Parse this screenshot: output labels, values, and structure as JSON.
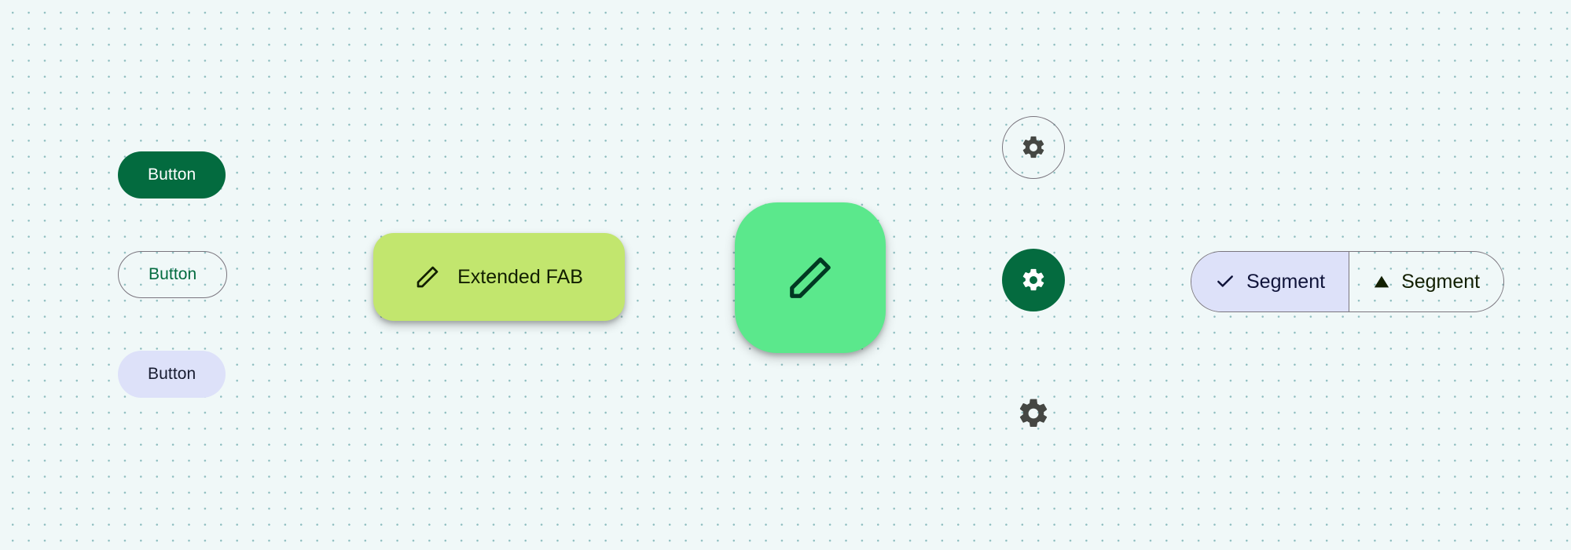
{
  "buttons": {
    "filled": "Button",
    "outlined": "Button",
    "tonal": "Button"
  },
  "extended_fab": {
    "label": "Extended FAB"
  },
  "segmented": {
    "segment1": "Segment",
    "segment2": "Segment"
  },
  "colors": {
    "primary": "#036b3f",
    "ext_fab_bg": "#c2e66e",
    "fab_bg": "#5be88c",
    "tonal_bg": "#dde1f9",
    "outline": "#7a757e"
  }
}
